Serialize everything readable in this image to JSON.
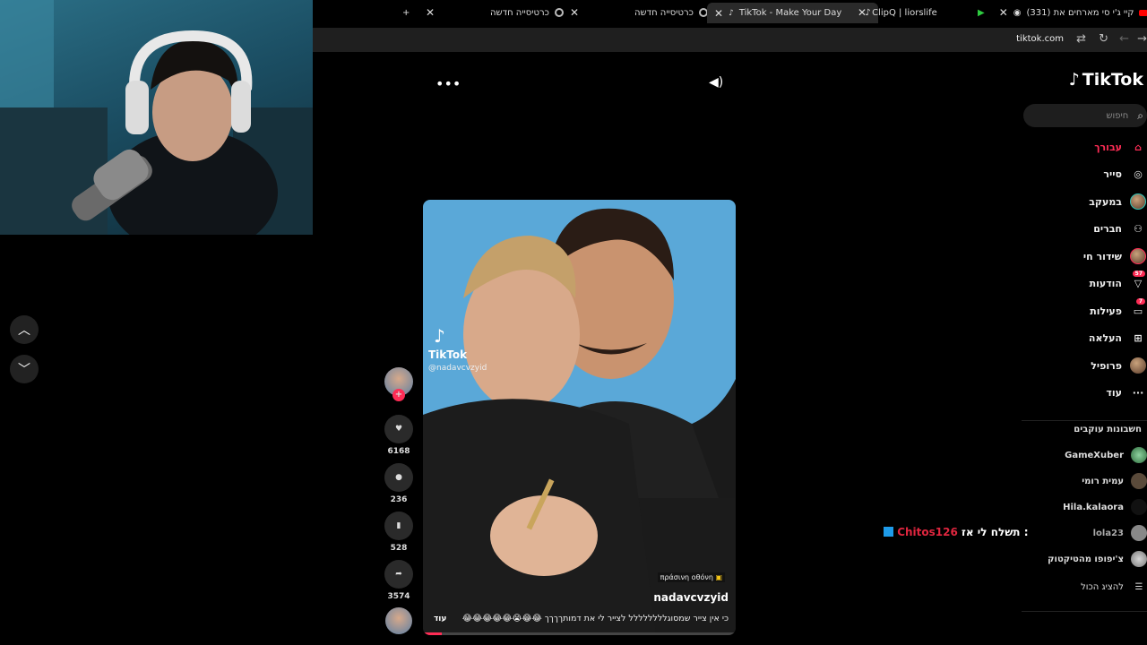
{
  "browser": {
    "tabs": [
      {
        "title": "כרטיסייה חדשה",
        "active": false
      },
      {
        "title": "כרטיסייה חדשה",
        "active": false
      },
      {
        "title": "TikTok - Make Your Day",
        "active": true
      },
      {
        "title": "ClipQ | liorslife",
        "active": false
      },
      {
        "title": "(331) קיי ג'י סי מארחים את",
        "active": false
      }
    ],
    "new_tab_label": "+",
    "url": "tiktok.com"
  },
  "tiktok": {
    "logo": "TikTok",
    "search_placeholder": "חיפוש",
    "nav": [
      {
        "label": "עבורך",
        "icon": "home-icon",
        "active": true
      },
      {
        "label": "סייר",
        "icon": "compass-icon"
      },
      {
        "label": "במעקב",
        "icon": "following-avatar-icon"
      },
      {
        "label": "חברים",
        "icon": "friends-icon"
      },
      {
        "label": "שידור חי",
        "icon": "live-avatar-icon"
      },
      {
        "label": "הודעות",
        "icon": "send-icon",
        "badge": "57"
      },
      {
        "label": "פעילות",
        "icon": "inbox-icon",
        "badge": "7"
      },
      {
        "label": "העלאה",
        "icon": "upload-icon"
      },
      {
        "label": "פרופיל",
        "icon": "profile-avatar-icon"
      },
      {
        "label": "עוד",
        "icon": "more-icon"
      }
    ],
    "following_title": "חשבונות עוקבים",
    "accounts": [
      "GameXuber",
      "עמית רומי",
      "Hila.kalaora",
      "lola23",
      "צ'יפופו מהטיקטוק"
    ],
    "show_all": "להציג הכול"
  },
  "video": {
    "watermark": "TikTok",
    "watermark_user": "@nadavcvzyid",
    "tag": "πράσινη οθόνη",
    "author": "nadavcvzyid",
    "caption": "כי אין צייר שמסוגלללללללל לצייר לי את דמותךךךך 😂😂😭😂😂😂😂😂",
    "more": "עוד",
    "likes": "6168",
    "comments": "236",
    "saves": "528",
    "shares": "3574"
  },
  "chat": {
    "message": "תשלח לי אז :",
    "user": "Chitos126"
  },
  "colors": {
    "accent": "#fe2c55",
    "chat_user": "#e0263f"
  }
}
